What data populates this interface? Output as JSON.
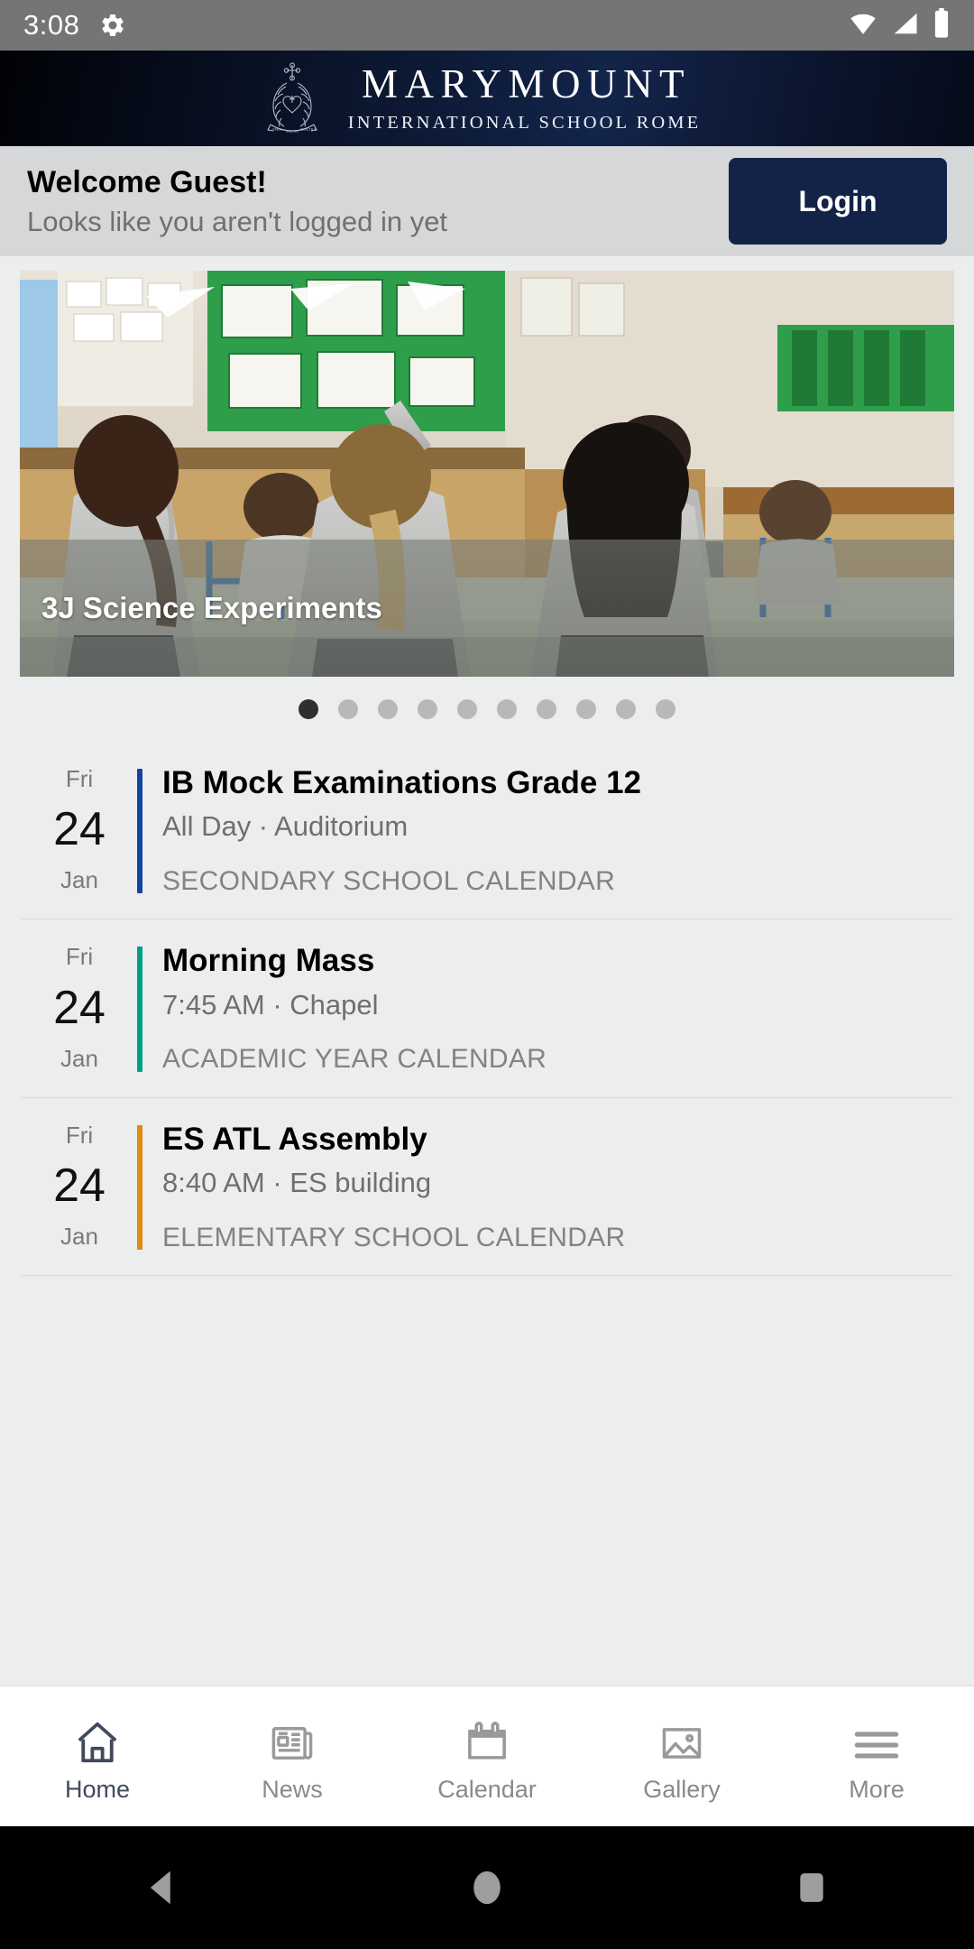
{
  "statusbar": {
    "time": "3:08",
    "gear_icon": "gear-icon",
    "wifi_icon": "wifi-icon",
    "signal_icon": "cellular-signal-icon",
    "battery_icon": "battery-full-icon"
  },
  "header": {
    "crest_icon": "school-crest-icon",
    "title": "MARYMOUNT",
    "subtitle": "INTERNATIONAL SCHOOL ROME",
    "background_start": "#010206",
    "background_mid": "#13244a"
  },
  "welcome": {
    "title": "Welcome Guest!",
    "subtitle": "Looks like you aren't logged in yet",
    "login_label": "Login",
    "login_color": "#132347",
    "background": "#d6d7d9"
  },
  "carousel": {
    "caption": "3J Science Experiments",
    "total_slides": 10,
    "active_slide": 1,
    "dot_active_color": "#2f2f2f",
    "dot_inactive_color": "#b7b8b8"
  },
  "events": [
    {
      "dow": "Fri",
      "day": "24",
      "month": "Jan",
      "title": "IB Mock Examinations Grade 12",
      "meta": "All Day · Auditorium",
      "calendar": "SECONDARY SCHOOL CALENDAR",
      "accent": "#1344a0"
    },
    {
      "dow": "Fri",
      "day": "24",
      "month": "Jan",
      "title": "Morning Mass",
      "meta": "7:45 AM · Chapel",
      "calendar": "ACADEMIC YEAR CALENDAR",
      "accent": "#00a086"
    },
    {
      "dow": "Fri",
      "day": "24",
      "month": "Jan",
      "title": "ES ATL Assembly",
      "meta": "8:40 AM · ES building",
      "calendar": "ELEMENTARY SCHOOL CALENDAR",
      "accent": "#e08a13"
    }
  ],
  "tabs": [
    {
      "label": "Home",
      "icon": "home-icon",
      "active": true
    },
    {
      "label": "News",
      "icon": "news-icon",
      "active": false
    },
    {
      "label": "Calendar",
      "icon": "calendar-icon",
      "active": false
    },
    {
      "label": "Gallery",
      "icon": "gallery-icon",
      "active": false
    },
    {
      "label": "More",
      "icon": "hamburger-menu-icon",
      "active": false
    }
  ],
  "androidnav": {
    "back_icon": "back-triangle-icon",
    "home_icon": "home-circle-icon",
    "recents_icon": "recents-square-icon"
  }
}
